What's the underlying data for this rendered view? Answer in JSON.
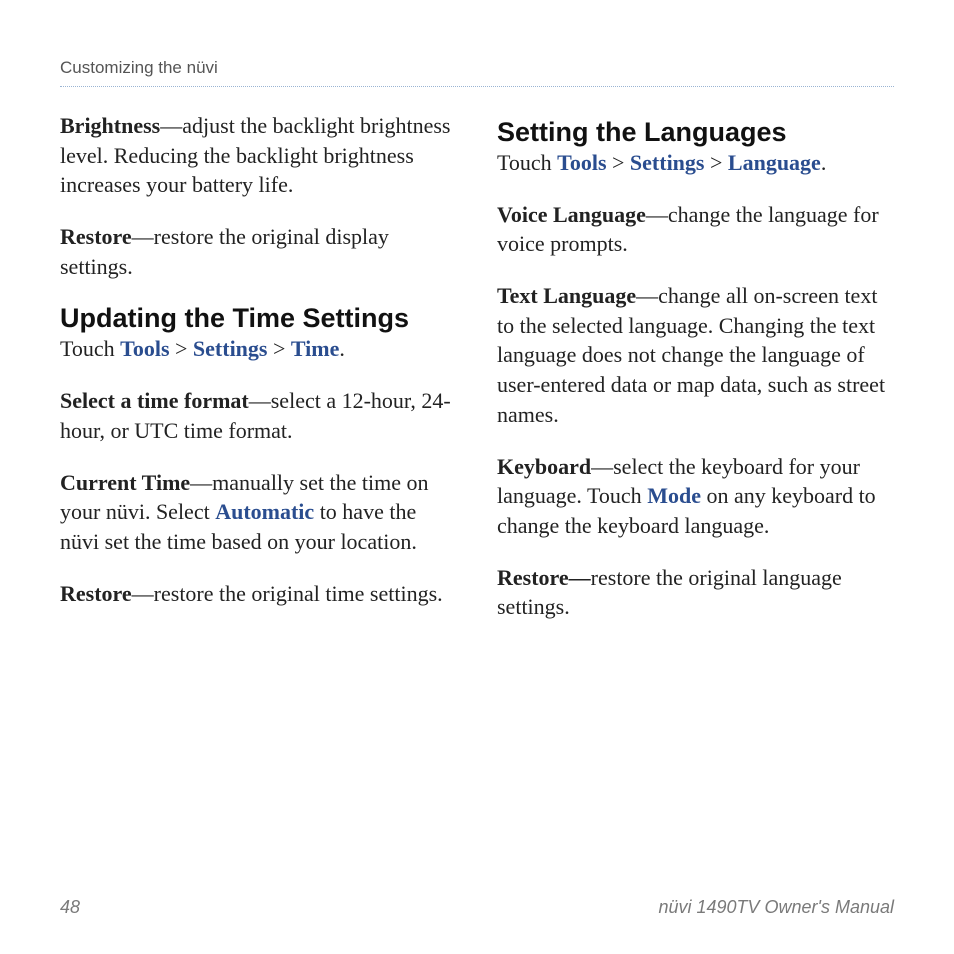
{
  "header": {
    "breadcrumb": "Customizing the nüvi"
  },
  "left": {
    "brightness_label": "Brightness",
    "brightness_text": "—adjust the backlight brightness level. Reducing the backlight brightness increases your battery life.",
    "restore1_label": "Restore",
    "restore1_text": "—restore the original display settings.",
    "h2_time": "Updating the Time Settings",
    "nav_prefix": "Touch ",
    "nav_tools": "Tools",
    "nav_settings": "Settings",
    "nav_time": "Time",
    "nav_suffix": ".",
    "sep1": " > ",
    "sep2": " > ",
    "timefmt_label": "Select a time format",
    "timefmt_text": "—select a 12-hour, 24-hour, or UTC time format.",
    "curtime_label": "Current Time",
    "curtime_text1": "—manually set the time on your nüvi. Select ",
    "curtime_auto": "Automatic",
    "curtime_text2": " to have the nüvi set the time based on your location.",
    "restore2_label": "Restore",
    "restore2_text": "—restore the original time settings."
  },
  "right": {
    "h2_lang": "Setting the Languages",
    "nav_prefix": "Touch ",
    "nav_tools": "Tools",
    "nav_settings": "Settings",
    "nav_language": "Language",
    "nav_suffix": ".",
    "sep1": " > ",
    "sep2": " > ",
    "voice_label": "Voice Language",
    "voice_text": "—change the language for voice prompts.",
    "textlang_label": "Text Language",
    "textlang_text": "—change all on-screen text to the selected language. Changing the text language does not change the language of user-entered data or map data, such as street names.",
    "keyboard_label": "Keyboard",
    "keyboard_text1": "—select the keyboard for your language. Touch ",
    "keyboard_mode": "Mode",
    "keyboard_text2": " on any keyboard to change the keyboard language.",
    "restore_label": "Restore—",
    "restore_text": "restore the original language settings."
  },
  "footer": {
    "page": "48",
    "title": "nüvi 1490TV Owner's Manual"
  }
}
